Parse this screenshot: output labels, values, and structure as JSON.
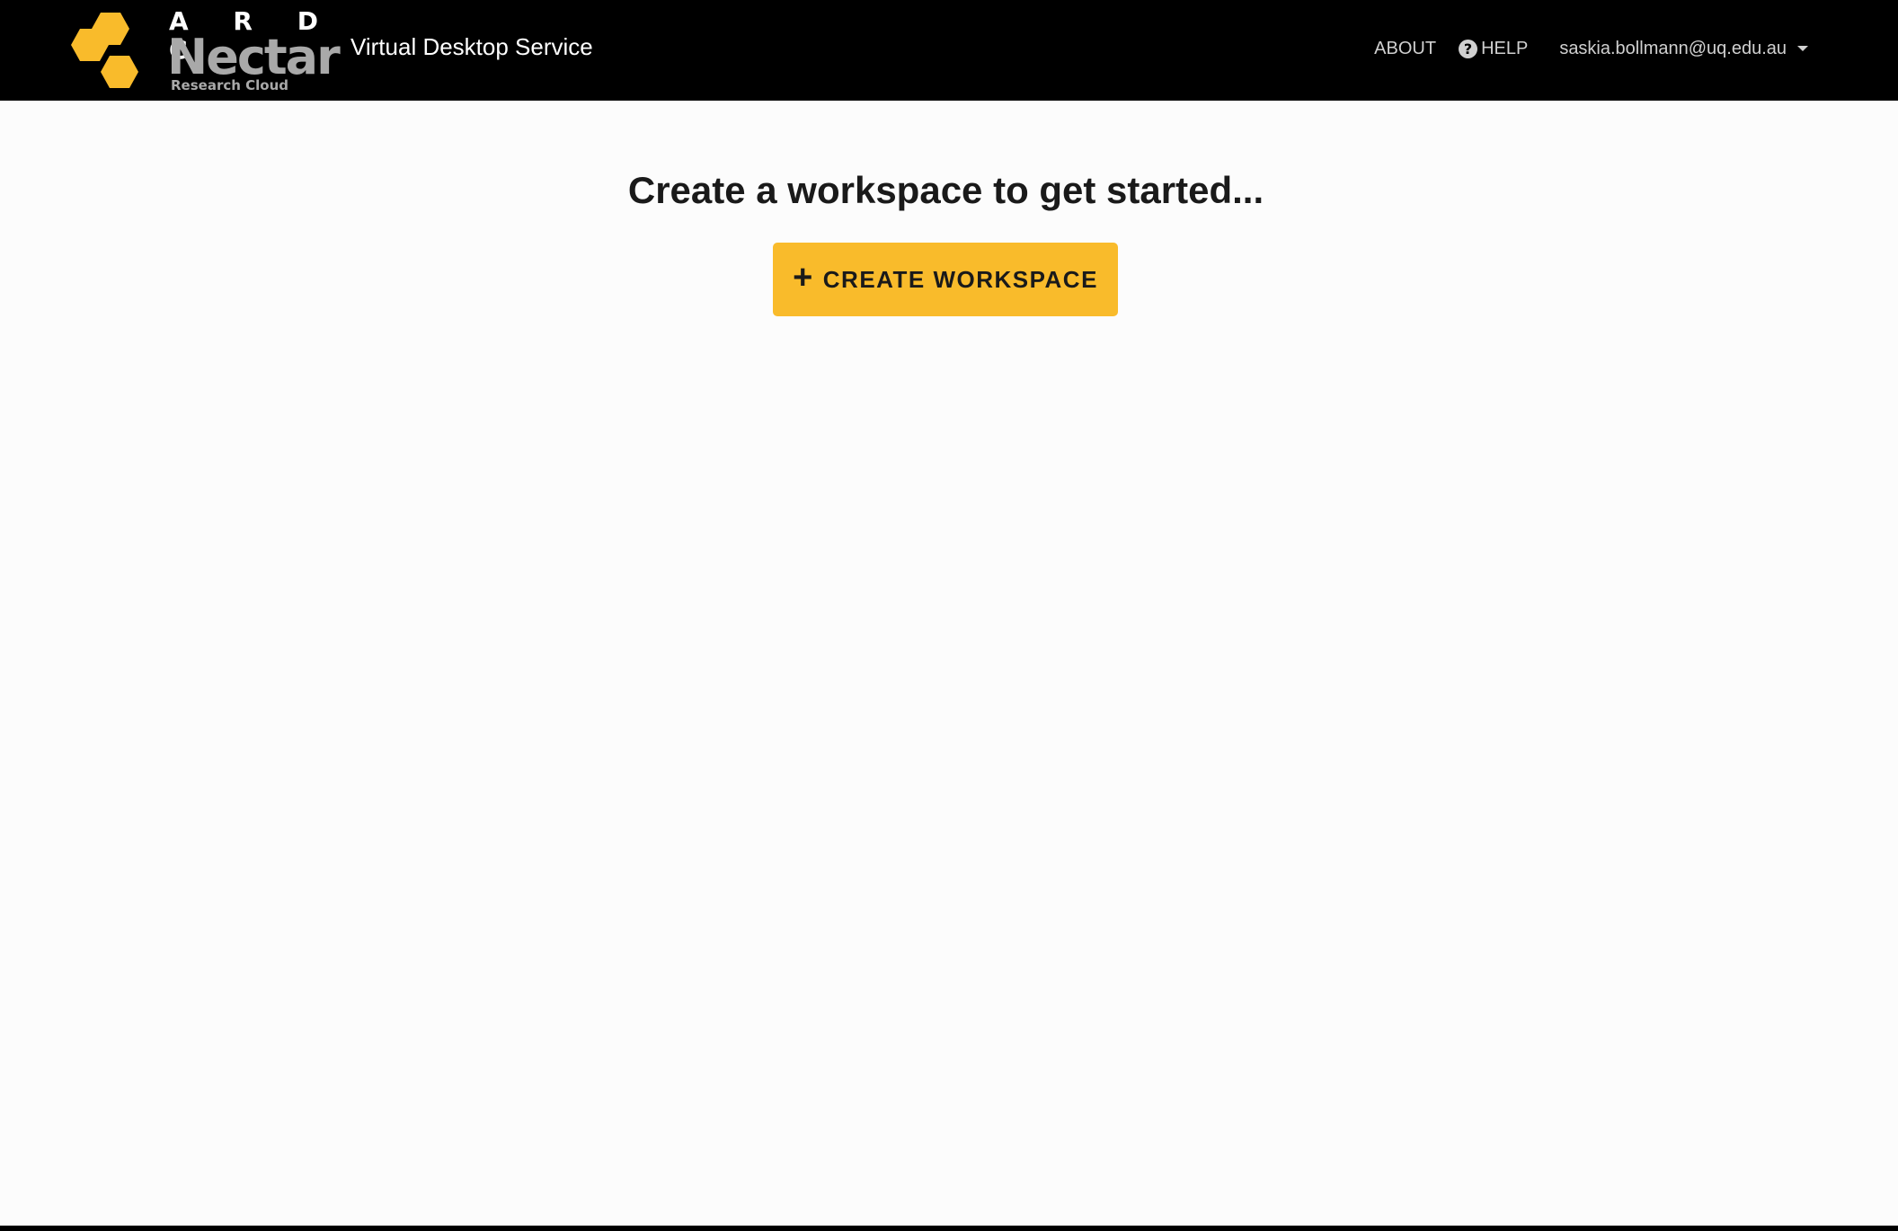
{
  "navbar": {
    "logo": {
      "line1": "A R D C",
      "line2": "Nectar",
      "line3": "Research Cloud"
    },
    "service_title": "Virtual Desktop Service",
    "about_label": "ABOUT",
    "help_label": "HELP",
    "help_icon": "?",
    "user_email": "saskia.bollmann@uq.edu.au"
  },
  "main": {
    "prompt": "Create a workspace to get started...",
    "create_button_label": "CREATE WORKSPACE",
    "create_button_icon": "+"
  },
  "colors": {
    "navbar_bg": "#000000",
    "accent": "#f9bb2b",
    "page_bg": "#fcfcfc"
  }
}
